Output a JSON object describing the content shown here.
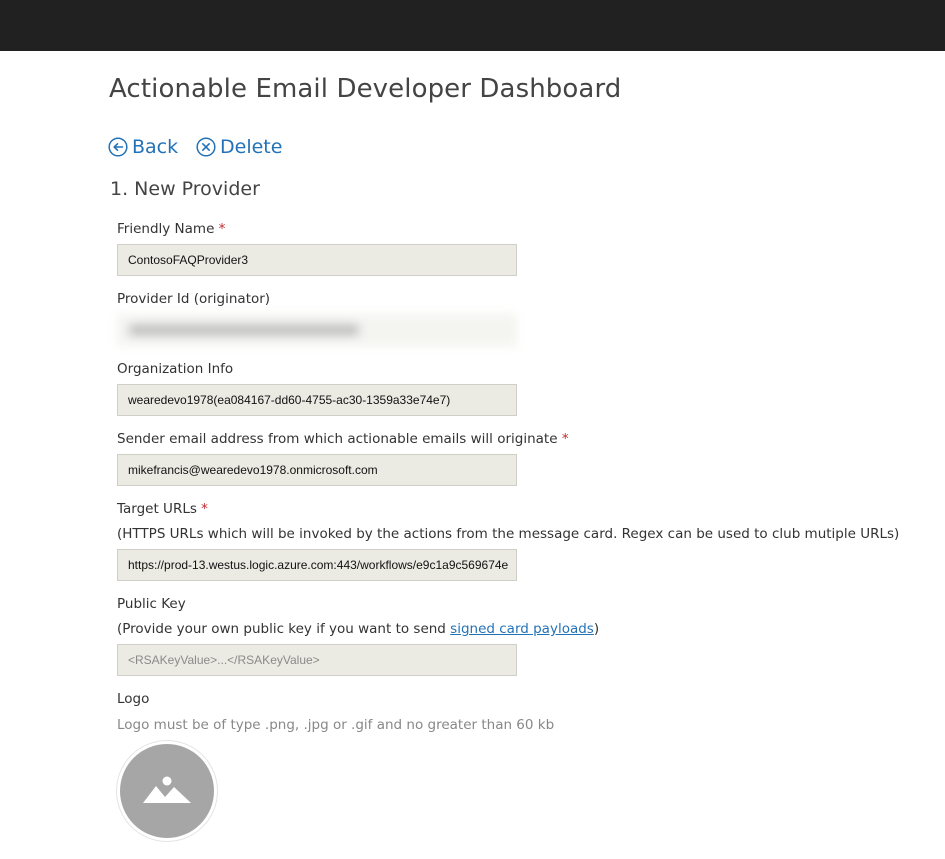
{
  "header": {
    "title": "Actionable Email Developer Dashboard"
  },
  "actions": {
    "back_label": "Back",
    "delete_label": "Delete"
  },
  "section": {
    "title": "1. New Provider"
  },
  "form": {
    "friendly_name": {
      "label": "Friendly Name",
      "required_mark": "*",
      "value": "ContosoFAQProvider3"
    },
    "provider_id": {
      "label": "Provider Id (originator)"
    },
    "organization_info": {
      "label": "Organization Info",
      "value": "wearedevo1978(ea084167-dd60-4755-ac30-1359a33e74e7)"
    },
    "sender_email": {
      "label": "Sender email address from which actionable emails will originate",
      "required_mark": "*",
      "value": "mikefrancis@wearedevo1978.onmicrosoft.com"
    },
    "target_urls": {
      "label": "Target URLs",
      "required_mark": "*",
      "helper": "(HTTPS URLs which will be invoked by the actions from the message card. Regex can be used to club mutiple URLs)",
      "value": "https://prod-13.westus.logic.azure.com:443/workflows/e9c1a9c569674e"
    },
    "public_key": {
      "label": "Public Key",
      "helper_prefix": "(Provide your own public key if you want to send ",
      "helper_link": "signed card payloads",
      "helper_suffix": ")",
      "placeholder": "<RSAKeyValue>...</RSAKeyValue>"
    },
    "logo": {
      "label": "Logo",
      "helper": "Logo must be of type .png, .jpg or .gif and no greater than 60 kb",
      "icon": "image-placeholder-icon"
    }
  },
  "colors": {
    "topbar": "#212121",
    "link": "#2372b8",
    "required": "#c4262e",
    "input_bg": "#ebebe4",
    "logo_placeholder": "#a6a6a6"
  }
}
